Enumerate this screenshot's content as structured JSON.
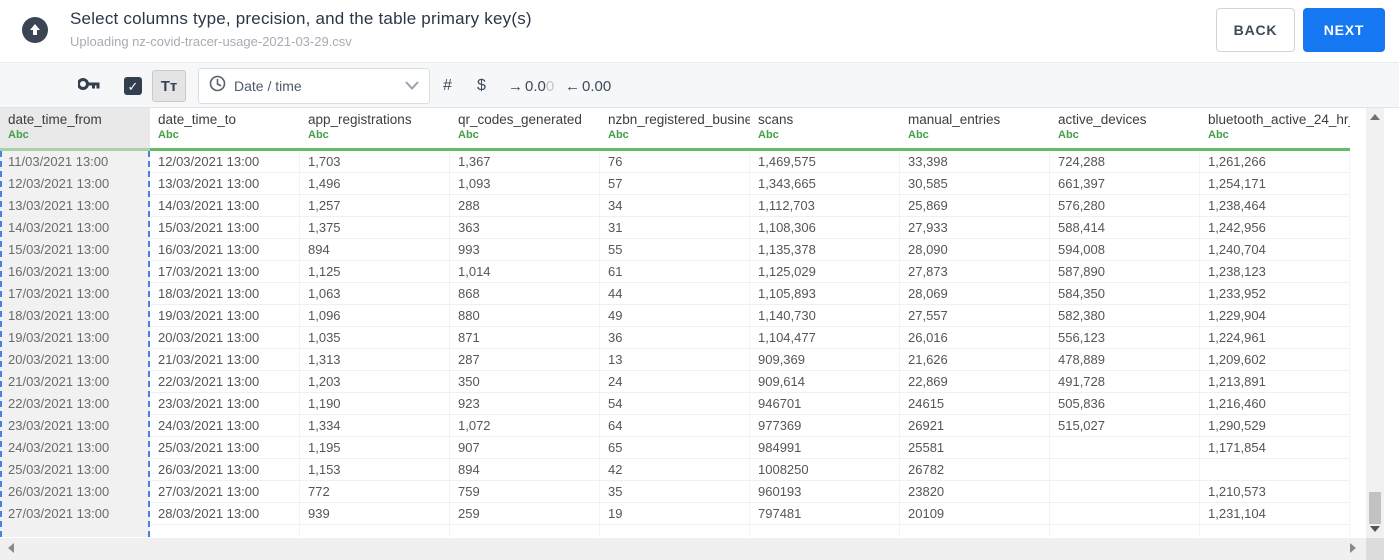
{
  "header": {
    "title": "Select columns type, precision, and the table primary key(s)",
    "subtitle": "Uploading nz-covid-tracer-usage-2021-03-29.csv",
    "back_label": "BACK",
    "next_label": "NEXT"
  },
  "toolbar": {
    "primary_key_icon": "key-icon",
    "checkbox_checked": true,
    "check_glyph": "✓",
    "text_type_label": "Tᴛ",
    "type_dropdown": {
      "icon": "clock-icon",
      "value": "Date / time"
    },
    "number_type_label": "#",
    "currency_type_label": "$",
    "increase_precision": {
      "arrow": "→",
      "value": "0.0",
      "faded": "0"
    },
    "decrease_precision": {
      "arrow": "←",
      "value": "0.00"
    }
  },
  "table": {
    "columns": [
      {
        "label": "date_time_from",
        "type": "Abc",
        "selected": true
      },
      {
        "label": "date_time_to",
        "type": "Abc",
        "selected": false
      },
      {
        "label": "app_registrations",
        "type": "Abc",
        "selected": false
      },
      {
        "label": "qr_codes_generated",
        "type": "Abc",
        "selected": false
      },
      {
        "label": "nzbn_registered_busine",
        "type": "Abc",
        "selected": false
      },
      {
        "label": "scans",
        "type": "Abc",
        "selected": false
      },
      {
        "label": "manual_entries",
        "type": "Abc",
        "selected": false
      },
      {
        "label": "active_devices",
        "type": "Abc",
        "selected": false
      },
      {
        "label": "bluetooth_active_24_hr_",
        "type": "Abc",
        "selected": false
      }
    ],
    "rows": [
      [
        "11/03/2021 13:00",
        "12/03/2021 13:00",
        "1,703",
        "1,367",
        "76",
        "1,469,575",
        "33,398",
        "724,288",
        "1,261,266"
      ],
      [
        "12/03/2021 13:00",
        "13/03/2021 13:00",
        "1,496",
        "1,093",
        "57",
        "1,343,665",
        "30,585",
        "661,397",
        "1,254,171"
      ],
      [
        "13/03/2021 13:00",
        "14/03/2021 13:00",
        "1,257",
        "288",
        "34",
        "1,112,703",
        "25,869",
        "576,280",
        "1,238,464"
      ],
      [
        "14/03/2021 13:00",
        "15/03/2021 13:00",
        "1,375",
        "363",
        "31",
        "1,108,306",
        "27,933",
        "588,414",
        "1,242,956"
      ],
      [
        "15/03/2021 13:00",
        "16/03/2021 13:00",
        "894",
        "993",
        "55",
        "1,135,378",
        "28,090",
        "594,008",
        "1,240,704"
      ],
      [
        "16/03/2021 13:00",
        "17/03/2021 13:00",
        "1,125",
        "1,014",
        "61",
        "1,125,029",
        "27,873",
        "587,890",
        "1,238,123"
      ],
      [
        "17/03/2021 13:00",
        "18/03/2021 13:00",
        "1,063",
        "868",
        "44",
        "1,105,893",
        "28,069",
        "584,350",
        "1,233,952"
      ],
      [
        "18/03/2021 13:00",
        "19/03/2021 13:00",
        "1,096",
        "880",
        "49",
        "1,140,730",
        "27,557",
        "582,380",
        "1,229,904"
      ],
      [
        "19/03/2021 13:00",
        "20/03/2021 13:00",
        "1,035",
        "871",
        "36",
        "1,104,477",
        "26,016",
        "556,123",
        "1,224,961"
      ],
      [
        "20/03/2021 13:00",
        "21/03/2021 13:00",
        "1,313",
        "287",
        "13",
        "909,369",
        "21,626",
        "478,889",
        "1,209,602"
      ],
      [
        "21/03/2021 13:00",
        "22/03/2021 13:00",
        "1,203",
        "350",
        "24",
        "909,614",
        "22,869",
        "491,728",
        "1,213,891"
      ],
      [
        "22/03/2021 13:00",
        "23/03/2021 13:00",
        "1,190",
        "923",
        "54",
        "946701",
        "24615",
        "505,836",
        "1,216,460"
      ],
      [
        "23/03/2021 13:00",
        "24/03/2021 13:00",
        "1,334",
        "1,072",
        "64",
        "977369",
        "26921",
        "515,027",
        "1,290,529"
      ],
      [
        "24/03/2021 13:00",
        "25/03/2021 13:00",
        "1,195",
        "907",
        "65",
        "984991",
        "25581",
        "",
        "1,171,854"
      ],
      [
        "25/03/2021 13:00",
        "26/03/2021 13:00",
        "1,153",
        "894",
        "42",
        "1008250",
        "26782",
        "",
        ""
      ],
      [
        "26/03/2021 13:00",
        "27/03/2021 13:00",
        "772",
        "759",
        "35",
        "960193",
        "23820",
        "",
        "1,210,573"
      ],
      [
        "27/03/2021 13:00",
        "28/03/2021 13:00",
        "939",
        "259",
        "19",
        "797481",
        "20109",
        "",
        "1,231,104"
      ]
    ]
  },
  "colors": {
    "accent_blue": "#1577f2",
    "selection_dash_blue": "#4a80e0",
    "type_green_bar": "#66bb6a",
    "abc_green": "#43a047",
    "dark_navy": "#333e50"
  }
}
